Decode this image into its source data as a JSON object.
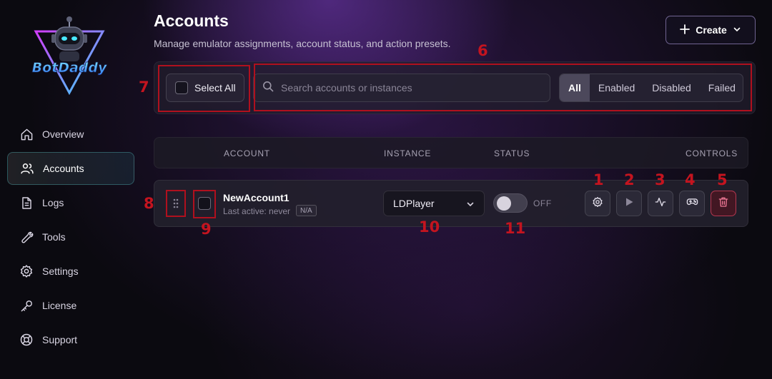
{
  "sidebar": {
    "logo_text": "BotDaddy",
    "items": [
      {
        "label": "Overview",
        "icon": "home-icon"
      },
      {
        "label": "Accounts",
        "icon": "users-icon",
        "active": true
      },
      {
        "label": "Logs",
        "icon": "file-icon"
      },
      {
        "label": "Tools",
        "icon": "wrench-icon"
      },
      {
        "label": "Settings",
        "icon": "gear-icon"
      },
      {
        "label": "License",
        "icon": "key-icon"
      },
      {
        "label": "Support",
        "icon": "lifebuoy-icon"
      }
    ]
  },
  "header": {
    "title": "Accounts",
    "subtitle": "Manage emulator assignments, account status, and action presets.",
    "create_label": "Create"
  },
  "toolbar": {
    "select_all_label": "Select All",
    "search_placeholder": "Search accounts or instances",
    "filters": [
      "All",
      "Enabled",
      "Disabled",
      "Failed"
    ],
    "active_filter": "All"
  },
  "table": {
    "columns": {
      "account": "ACCOUNT",
      "instance": "INSTANCE",
      "status": "STATUS",
      "controls": "CONTROLS"
    },
    "rows": [
      {
        "name": "NewAccount1",
        "last_active": "Last active: never",
        "badge": "N/A",
        "instance": "LDPlayer",
        "status_label": "OFF",
        "enabled": false
      }
    ]
  },
  "annotations": [
    "1",
    "2",
    "3",
    "4",
    "5",
    "6",
    "7",
    "8",
    "9",
    "10",
    "11"
  ],
  "colors": {
    "accent_teal": "#5ac8c8",
    "annotation_red": "#c4141f",
    "danger": "#e6466a"
  }
}
